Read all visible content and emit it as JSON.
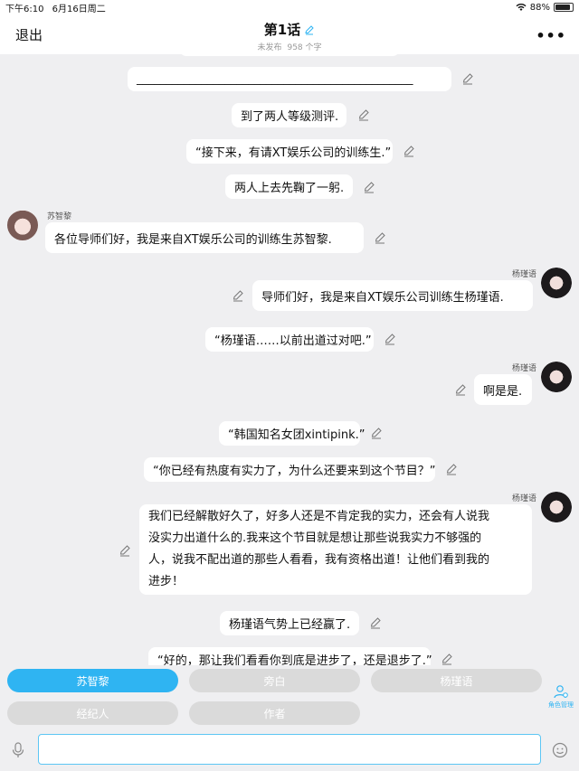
{
  "status_bar": {
    "time": "下午6:10",
    "date": "6月16日周二",
    "battery": "88%"
  },
  "header": {
    "back_label": "退出",
    "title": "第1话",
    "status": "未发布",
    "word_count": "958 个字",
    "more_label": "•••"
  },
  "messages": {
    "m0": "_______________________________________________",
    "m1": "到了两人等级测评.",
    "m2": "“接下来，有请XT娱乐公司的训练生.”",
    "m3": "两人上去先鞠了一躬.",
    "m4_name": "苏智黎",
    "m4": "各位导师们好，我是来自XT娱乐公司的训练生苏智黎.",
    "m5_name": "杨瑾语",
    "m5": "导师们好，我是来自XT娱乐公司训练生杨瑾语.",
    "m6": "“杨瑾语……以前出道过对吧.”",
    "m7_name": "杨瑾语",
    "m7": "啊是是.",
    "m8": "“韩国知名女团xintipink.”",
    "m9": "“你已经有热度有实力了，为什么还要来到这个节目？”",
    "m10_name": "杨瑾语",
    "m10_l1": "我们已经解散好久了，好多人还是不肯定我的实力，还会有人说我",
    "m10_l2": "没实力出道什么的.我来这个节目就是想让那些说我实力不够强的",
    "m10_l3": "人，说我不配出道的那些人看看，我有资格出道！让他们看到我的",
    "m10_l4": "进步！",
    "m11": "杨瑾语气势上已经赢了.",
    "m12": "“好的，那让我们看看你到底是进步了，还是退步了.”"
  },
  "roles": {
    "r1": "苏智黎",
    "r2": "旁白",
    "r3": "杨瑾语",
    "r4": "经纪人",
    "r5": "作者",
    "manage_label": "角色管理"
  },
  "input": {
    "placeholder": ""
  },
  "colors": {
    "accent": "#2fb4f2",
    "background": "#efeff1",
    "inactive_role": "#dadada"
  }
}
